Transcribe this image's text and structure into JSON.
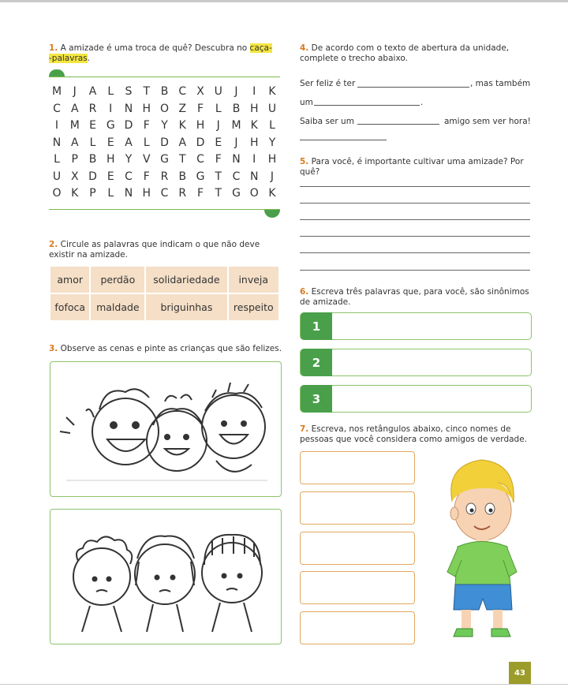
{
  "q1": {
    "number": "1.",
    "text_a": " A amizade é uma troca de quê? Descubra no ",
    "hl1": "caça-",
    "hl2": "-palavras",
    "end": "."
  },
  "wordsearch": {
    "rows": [
      [
        "M",
        "J",
        "A",
        "L",
        "S",
        "T",
        "B",
        "C",
        "X",
        "U",
        "J",
        "I",
        "K"
      ],
      [
        "C",
        "A",
        "R",
        "I",
        "N",
        "H",
        "O",
        "Z",
        "F",
        "L",
        "B",
        "H",
        "U"
      ],
      [
        "I",
        "M",
        "E",
        "G",
        "D",
        "F",
        "Y",
        "K",
        "H",
        "J",
        "M",
        "K",
        "L"
      ],
      [
        "N",
        "A",
        "L",
        "E",
        "A",
        "L",
        "D",
        "A",
        "D",
        "E",
        "J",
        "H",
        "Y"
      ],
      [
        "L",
        "P",
        "B",
        "H",
        "Y",
        "V",
        "G",
        "T",
        "C",
        "F",
        "N",
        "I",
        "H"
      ],
      [
        "U",
        "X",
        "D",
        "E",
        "C",
        "F",
        "R",
        "B",
        "G",
        "T",
        "C",
        "N",
        "J"
      ],
      [
        "O",
        "K",
        "P",
        "L",
        "N",
        "H",
        "C",
        "R",
        "F",
        "T",
        "G",
        "O",
        "K"
      ]
    ]
  },
  "q2": {
    "number": "2.",
    "text": " Circule as palavras que indicam o que não deve existir na amizade.",
    "words": [
      [
        "amor",
        "perdão",
        "solidariedade",
        "inveja"
      ],
      [
        "fofoca",
        "maldade",
        "briguinhas",
        "respeito"
      ]
    ]
  },
  "q3": {
    "number": "3.",
    "text": " Observe as cenas e pinte as crianças que são felizes."
  },
  "q4": {
    "number": "4.",
    "text": " De acordo com o texto de abertura da unidade, complete o trecho abaixo.",
    "line1_a": "Ser feliz é ter",
    "line1_b": ", mas também",
    "line2": "um",
    "line2_end": ".",
    "line3_a": "Saiba ser um",
    "line3_b": "amigo sem ver hora!"
  },
  "q5": {
    "number": "5.",
    "text": " Para você, é importante cultivar uma amizade? Por quê?"
  },
  "q6": {
    "number": "6.",
    "text": " Escreva três palavras que, para você, são sinônimos de amizade.",
    "items": [
      "1",
      "2",
      "3"
    ]
  },
  "q7": {
    "number": "7.",
    "text": " Escreva, nos retângulos abaixo, cinco nomes de pessoas que você considera como amigos de verdade."
  },
  "page_number": "43",
  "colors": {
    "accent_green": "#4aa04a",
    "question_orange": "#d97b1f",
    "highlight": "#f4e640",
    "table_bg": "#f5dfc7"
  }
}
